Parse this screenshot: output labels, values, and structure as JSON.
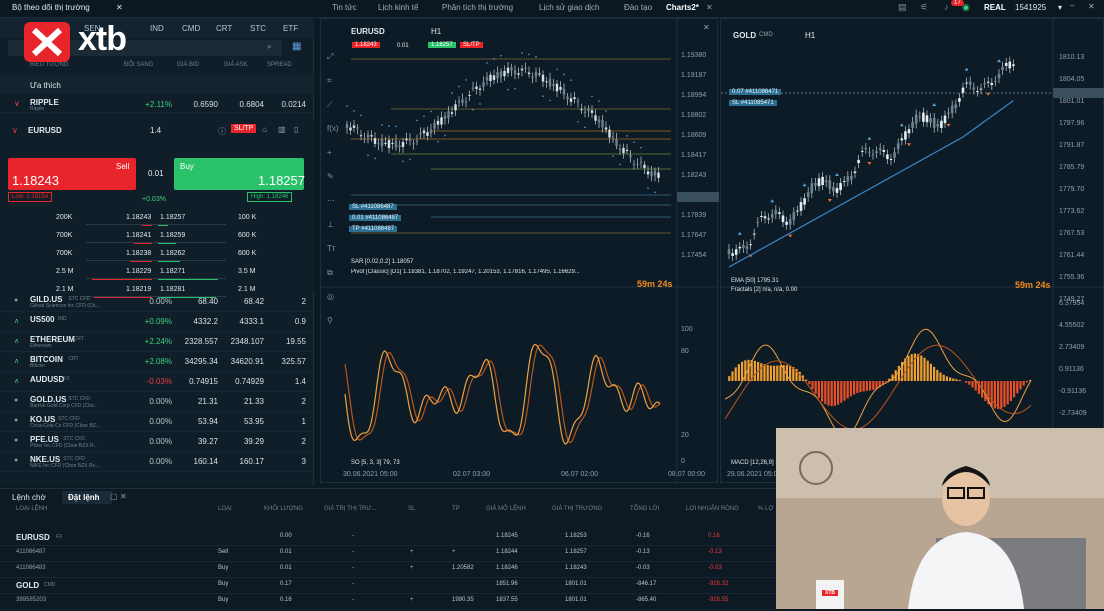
{
  "brand": {
    "logo": "xtb",
    "accent": "#e8252b"
  },
  "topbar": {
    "tabs": [
      "Tin tức",
      "Lịch kinh tế",
      "Phân tích thị trường",
      "Lịch sử giao dịch",
      "Đào tạo",
      "Charts2*"
    ],
    "account_type": "REAL",
    "account_number": "1541925",
    "badge": "17"
  },
  "left": {
    "title": "Bộ theo dõi thị trường",
    "cat_tabs": [
      "SEN",
      "IND",
      "CMD",
      "CRT",
      "STC",
      "ETF"
    ],
    "headers": [
      "ĐỔI SANG",
      "GIÁ BID",
      "GIÁ ASK",
      "SPREAD"
    ],
    "header_left": "BIỂU TƯỢNG",
    "favorites": "Ưa thích",
    "ripple": {
      "sym": "RIPPLE",
      "badge": "CRT",
      "sub": "Ripple",
      "change": "+2.11%",
      "bid": "0.6590",
      "ask": "0.6804",
      "spread": "0.0214"
    },
    "eurusd": {
      "sym": "EURUSD",
      "badge": "FX",
      "lot": "1.4",
      "sltp": "SL/TP",
      "sell_label": "Sell",
      "buy_label": "Buy",
      "sell_price": "1.18243",
      "buy_price": "1.18257",
      "spread": "0.01",
      "low": "Low: 1.18154",
      "high": "High: 1.18246",
      "change": "+0.03%",
      "depth": [
        {
          "lv": "200K",
          "bid": "1.18243",
          "ask": "1.18257",
          "rv": "100 K"
        },
        {
          "lv": "700K",
          "bid": "1.18241",
          "ask": "1.18259",
          "rv": "600 K"
        },
        {
          "lv": "700K",
          "bid": "1.18238",
          "ask": "1.18262",
          "rv": "600 K"
        },
        {
          "lv": "2.5 M",
          "bid": "1.18229",
          "ask": "1.18271",
          "rv": "3.5 M"
        },
        {
          "lv": "2.1 M",
          "bid": "1.18219",
          "ask": "1.18281",
          "rv": "2.1 M"
        }
      ]
    },
    "rows": [
      {
        "sym": "GILD.US",
        "badge": "STC CFD",
        "sub": "Gilead Sciences Inc CFD (Cb...",
        "change": "0.00%",
        "bid": "68.40",
        "ask": "68.42",
        "spread": "2",
        "dir": "flat"
      },
      {
        "sym": "US500",
        "badge": "IND",
        "sub": "",
        "change": "+0.09%",
        "bid": "4332.2",
        "ask": "4333.1",
        "spread": "0.9",
        "dir": "up"
      },
      {
        "sym": "ETHEREUM",
        "badge": "CRT",
        "sub": "Ethereum",
        "change": "+2.24%",
        "bid": "2328.557",
        "ask": "2348.107",
        "spread": "19.55",
        "dir": "up"
      },
      {
        "sym": "BITCOIN",
        "badge": "CRT",
        "sub": "Bitcoin",
        "change": "+2.08%",
        "bid": "34295.34",
        "ask": "34620.91",
        "spread": "325.57",
        "dir": "up"
      },
      {
        "sym": "AUDUSD",
        "badge": "FX",
        "sub": "",
        "change": "-0.03%",
        "bid": "0.74915",
        "ask": "0.74929",
        "spread": "1.4",
        "dir": "up"
      },
      {
        "sym": "GOLD.US",
        "badge": "STC CFD",
        "sub": "Barrick Gold Corp CFD (Cbo...",
        "change": "0.00%",
        "bid": "21.31",
        "ask": "21.33",
        "spread": "2",
        "dir": "flat"
      },
      {
        "sym": "KO.US",
        "badge": "STC CFD",
        "sub": "Coca-Cola Co CFD (Cboe BZ...",
        "change": "0.00%",
        "bid": "53.94",
        "ask": "53.95",
        "spread": "1",
        "dir": "flat"
      },
      {
        "sym": "PFE.US",
        "badge": "STC CFD",
        "sub": "Pfizer Inc CFD (Cboe BZX R...",
        "change": "0.00%",
        "bid": "39.27",
        "ask": "39.29",
        "spread": "2",
        "dir": "flat"
      },
      {
        "sym": "NKE.US",
        "badge": "STC CFD",
        "sub": "NIKE Inc CFD (Cboe BZX Re...",
        "change": "0.00%",
        "bid": "160.14",
        "ask": "160.17",
        "spread": "3",
        "dir": "flat"
      }
    ]
  },
  "chart1": {
    "symbol": "EURUSD",
    "tf": "H1",
    "sell": "1.18243",
    "vol": "0.01",
    "buy": "1.18257",
    "sltp": "SL/TP",
    "prices": [
      "1.19380",
      "1.19187",
      "1.18994",
      "1.18802",
      "1.18609",
      "1.18417",
      "1.18243",
      "1.18032",
      "1.17839",
      "1.17647",
      "1.17454"
    ],
    "sl": "SL  #411086487",
    "qty": "0.01  #411086487",
    "tp": "TP  #411086487",
    "countdown": "59m 24s",
    "ind1": "SAR [0.02,0.2] 1.18057",
    "ind2": "Pivot [Classic] [D1] 1.18381, 1.18702, 1.19247, 1.20153, 1.17816, 1.17495, 1.16629...",
    "osc_label": "SO [5, 3, 3] 79, 73",
    "osc_levels": [
      "100",
      "80",
      "20",
      "0"
    ],
    "dates": [
      "30.06.2021 05:00",
      "02.07 03:00",
      "06.07 02:00",
      "08.07 00:00"
    ]
  },
  "chart2": {
    "symbol": "GOLD",
    "badge": "CMD",
    "tf": "H1",
    "order1": "0.07  #411086471",
    "order2": "SL  #411085471",
    "prices": [
      "1810.13",
      "1804.05",
      "1801.01",
      "1797.96",
      "1791.87",
      "1785.79",
      "1779.70",
      "1773.62",
      "1767.53",
      "1761.44",
      "1755.36",
      "1749.27"
    ],
    "ind1": "EMA [50] 1795.31",
    "ind2": "Fractals [2] n/a, n/a, 0.00",
    "countdown": "59m 24s",
    "macd_levels": [
      "6.37954",
      "4.55502",
      "2.73409",
      "0.91136",
      "-0.91136",
      "-2.73409"
    ],
    "macd_label": "MACD [12,26,9] 1.43,",
    "date": "29.06.2021 05:00"
  },
  "bottom": {
    "tabs": [
      "Lệnh chờ",
      "Đặt lệnh"
    ],
    "headers": [
      "LOẠI LỆNH",
      "LOẠI",
      "KHỐI LƯỢNG",
      "GIÁ TRỊ THỊ TRƯ...",
      "SL",
      "TP",
      "GIÁ MỞ LỆNH",
      "GIÁ THỊ TRƯỜNG",
      "TỔNG LỜI",
      "LỢI NHUẬN RÒNG",
      "% LỢ"
    ],
    "rows": [
      {
        "sym": "EURUSD",
        "badge": "FX",
        "n": "2",
        "type": "",
        "vol": "0.00",
        "mv": "-",
        "sl": "",
        "tp": "",
        "open": "1.18245",
        "market": "1.18253",
        "gross": "-0.16",
        "net": "0.16",
        "bold": true
      },
      {
        "sym": "411086487",
        "badge": "",
        "n": "",
        "type": "Sell",
        "vol": "0.01",
        "mv": "-",
        "sl": "+",
        "tp": "+",
        "open": "1.18244",
        "market": "1.18257",
        "gross": "-0.13",
        "net": "-0.13",
        "bold": false
      },
      {
        "sym": "411086483",
        "badge": "",
        "n": "",
        "type": "Buy",
        "vol": "0.01",
        "mv": "-",
        "sl": "+",
        "tp": "1.20582",
        "open": "1.18246",
        "market": "1.18243",
        "gross": "-0.03",
        "net": "-0.03",
        "bold": false
      },
      {
        "sym": "GOLD",
        "badge": "CMD",
        "n": "3",
        "type": "Buy",
        "vol": "0.17",
        "mv": "-",
        "sl": "",
        "tp": "",
        "open": "1851.96",
        "market": "1801.01",
        "gross": "-846.17",
        "net": "-926.32",
        "bold": true
      },
      {
        "sym": "399585203",
        "badge": "",
        "n": "",
        "type": "Buy",
        "vol": "0.16",
        "mv": "-",
        "sl": "+",
        "tp": "1990.35",
        "open": "1837.55",
        "market": "1801.01",
        "gross": "-865.40",
        "net": "-926.55",
        "bold": false
      }
    ]
  },
  "video": {
    "mug_logo": "XTB"
  }
}
